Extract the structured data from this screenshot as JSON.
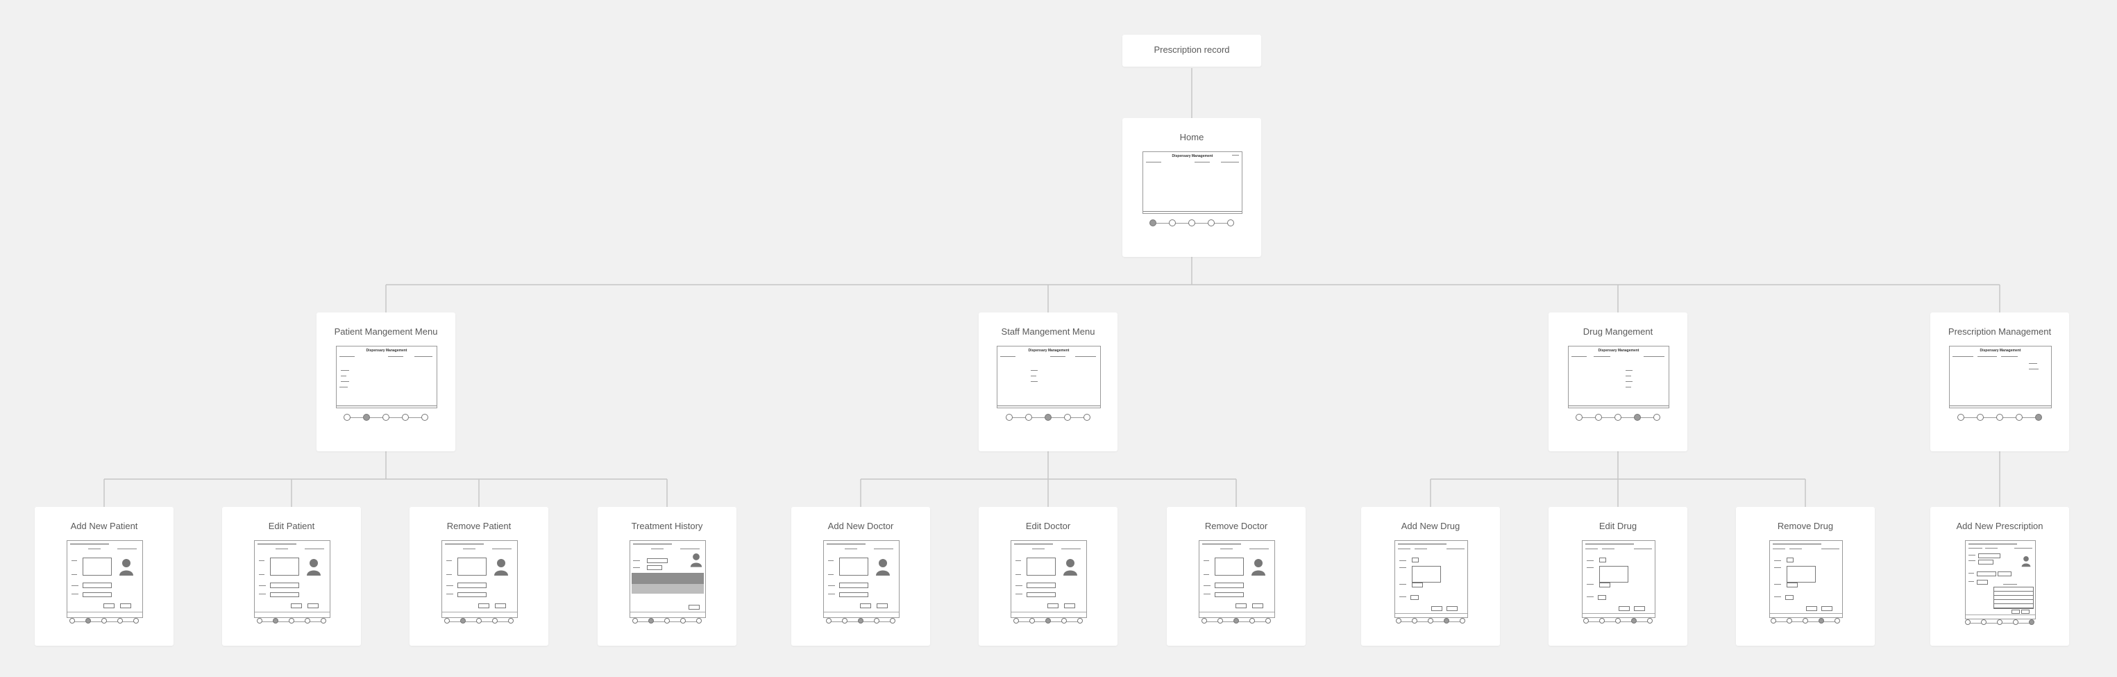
{
  "diagram": {
    "root": {
      "id": "root",
      "label": "Prescription record"
    },
    "home": {
      "id": "home",
      "label": "Home"
    },
    "menus": [
      {
        "id": "patient-menu",
        "label": "Patient Mangement Menu"
      },
      {
        "id": "staff-menu",
        "label": "Staff Mangement Menu"
      },
      {
        "id": "drug-menu",
        "label": "Drug Mangement"
      },
      {
        "id": "prescription-menu",
        "label": "Prescription Management"
      }
    ],
    "leaves": [
      {
        "id": "add-patient",
        "label": "Add New Patient",
        "parent": "patient-menu"
      },
      {
        "id": "edit-patient",
        "label": "Edit Patient",
        "parent": "patient-menu"
      },
      {
        "id": "remove-patient",
        "label": "Remove Patient",
        "parent": "patient-menu"
      },
      {
        "id": "treatment-history",
        "label": "Treatment History",
        "parent": "patient-menu"
      },
      {
        "id": "add-doctor",
        "label": "Add New Doctor",
        "parent": "staff-menu"
      },
      {
        "id": "edit-doctor",
        "label": "Edit Doctor",
        "parent": "staff-menu"
      },
      {
        "id": "remove-doctor",
        "label": "Remove Doctor",
        "parent": "staff-menu"
      },
      {
        "id": "add-drug",
        "label": "Add New Drug",
        "parent": "drug-menu"
      },
      {
        "id": "edit-drug",
        "label": "Edit Drug",
        "parent": "drug-menu"
      },
      {
        "id": "remove-drug",
        "label": "Remove Drug",
        "parent": "drug-menu"
      },
      {
        "id": "add-prescription",
        "label": "Add New Prescription",
        "parent": "prescription-menu"
      }
    ],
    "thumbnail_title": "Dispensary Management",
    "colors": {
      "background": "#f1f1f1",
      "node_fill": "#ffffff",
      "connector": "#c6c6c6",
      "label_text": "#5a5a5a"
    }
  }
}
